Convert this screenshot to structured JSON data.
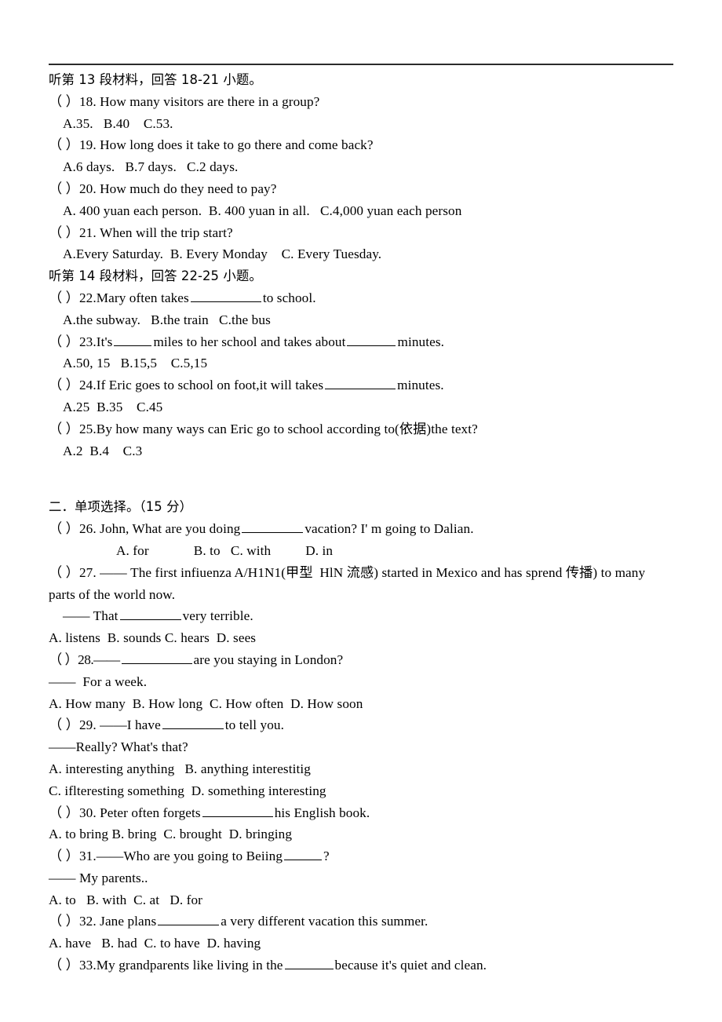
{
  "document": {
    "type": "exam-paper-scan",
    "language": "zh-en",
    "rule_above": true
  },
  "listening": {
    "section13_heading": "听第 13 段材料，回答 18-21 小题。",
    "section14_heading": "听第 14 段材料，回答 22-25 小题。",
    "q18": {
      "stem": "（ ）18. How many visitors are there in a group?",
      "options": "A.35.   B.40    C.53."
    },
    "q19": {
      "stem": "（ ）19. How long does it take to go there and come back?",
      "options": "A.6 days.   B.7 days.   C.2 days."
    },
    "q20": {
      "stem": "（ ）20. How much do they need to pay?",
      "options": "A. 400 yuan each person.  B. 400 yuan in all.   C.4,000 yuan each person"
    },
    "q21": {
      "stem": "（ ）21. When will the trip start?",
      "options": "A.Every Saturday.  B. Every Monday    C. Every Tuesday."
    },
    "q22": {
      "stem_before": "（ ）22.Mary often takes",
      "stem_after": "to school.",
      "options": "A.the subway.   B.the train   C.the bus"
    },
    "q23": {
      "stem_a": "（ ）23.It's",
      "stem_b": "miles to her school and takes about",
      "stem_c": "minutes.",
      "options": "A.50, 15   B.15,5    C.5,15"
    },
    "q24": {
      "stem_before": "（ ）24.If Eric goes to school on foot,it will takes",
      "stem_after": "minutes.",
      "options": "A.25  B.35    C.45"
    },
    "q25": {
      "stem": "（ ）25.By how many ways can Eric go to school according to(依据)the text?",
      "options": "A.2  B.4    C.3"
    }
  },
  "multiple_choice": {
    "heading": "二．单项选择。（15 分）",
    "q26": {
      "stem_before": "（ ）26. John, What are you doing",
      "stem_after": "vacation? I' m going to Dalian.",
      "options": "A. for             B. to   C. with          D. in"
    },
    "q27": {
      "stem_line1": "（ ）27. —— The first infiuenza A/H1N1(甲型  HlN 流感) started in Mexico and has sprend 传播) to many",
      "stem_line2": "parts of the world now.",
      "reply_before": "—— That",
      "reply_after": "very terrible.",
      "options": "A. listens  B. sounds C. hears  D. sees"
    },
    "q28": {
      "stem_before": "（ ）28.——",
      "stem_after": "are you staying in London?",
      "reply": "——  For a week.",
      "options": "A. How many  B. How long  C. How often  D. How soon"
    },
    "q29": {
      "stem_before": "（ ）29. ——I have",
      "stem_after": "to tell you.",
      "reply": "——Really? What's that?",
      "options_line1": "A. interesting anything   B. anything interestitig",
      "options_line2": "C. iflteresting something  D. something interesting"
    },
    "q30": {
      "stem_before": "（ ）30. Peter often forgets",
      "stem_after": "his English book.",
      "options": "A. to bring B. bring  C. brought  D. bringing"
    },
    "q31": {
      "stem_before": "（ ）31.——Who are you going to Beiing",
      "stem_after": "?",
      "reply": "—— My parents..",
      "options": "A. to   B. with  C. at   D. for"
    },
    "q32": {
      "stem_before": "（ ）32. Jane plans",
      "stem_after": "a very different vacation this summer.",
      "options": "A. have   B. had  C. to have  D. having"
    },
    "q33": {
      "stem_before": "（ ）33.My grandparents like living in the",
      "stem_after": "because it's quiet and clean."
    }
  }
}
